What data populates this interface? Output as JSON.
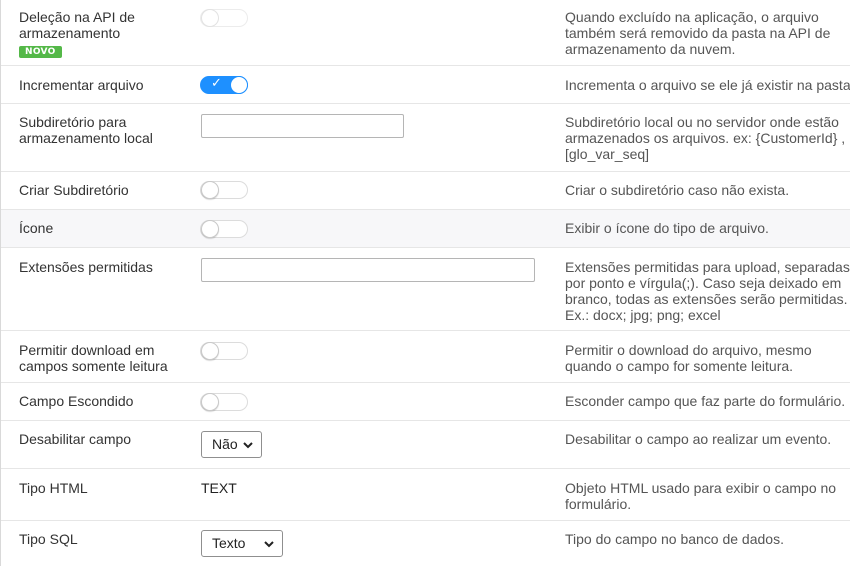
{
  "badge_new": "NOVO",
  "rows": [
    {
      "label": "Deleção na API de armazenamento",
      "desc": "Quando excluído na aplicação, o arquivo também será removido da pasta na API de armazenamento da nuvem.",
      "control": "toggle",
      "state": "off"
    },
    {
      "label": "Incrementar arquivo",
      "desc": "Incrementa o arquivo se ele já existir na pasta.",
      "control": "toggle",
      "state": "on"
    },
    {
      "label": "Subdiretório para armazenamento local",
      "desc": "Subdiretório local ou no servidor onde estão armazenados os arquivos. ex: {CustomerId} , [glo_var_seq]",
      "control": "input",
      "value": ""
    },
    {
      "label": "Criar Subdiretório",
      "desc": "Criar o subdiretório caso não exista.",
      "control": "toggle",
      "state": "off"
    },
    {
      "label": "Ícone",
      "desc": "Exibir o ícone do tipo de arquivo.",
      "control": "toggle",
      "state": "off"
    },
    {
      "label": "Extensões permitidas",
      "desc": "Extensões permitidas para upload, separadas por ponto e vírgula(;). Caso seja deixado em branco, todas as extensões serão permitidas. Ex.: docx; jpg; png; excel",
      "control": "input",
      "value": ""
    },
    {
      "label": "Permitir download em campos somente leitura",
      "desc": "Permitir o download do arquivo, mesmo quando o campo for somente leitura.",
      "control": "toggle",
      "state": "off"
    },
    {
      "label": "Campo Escondido",
      "desc": "Esconder campo que faz parte do formulário.",
      "control": "toggle",
      "state": "off"
    },
    {
      "label": "Desabilitar campo",
      "desc": "Desabilitar o campo ao realizar um evento.",
      "control": "select",
      "value": "Não"
    },
    {
      "label": "Tipo HTML",
      "desc": "Objeto HTML usado para exibir o campo no formulário.",
      "control": "text",
      "value": "TEXT"
    },
    {
      "label": "Tipo SQL",
      "desc": "Tipo do campo no banco de dados.",
      "control": "select",
      "value": "Texto"
    }
  ],
  "check_glyph": "✓",
  "icons": {
    "toggle_check": "check-icon",
    "select_chevron": "chevron-down-icon"
  },
  "colors": {
    "toggle_on": "#1e90ff",
    "badge": "#54b848"
  }
}
